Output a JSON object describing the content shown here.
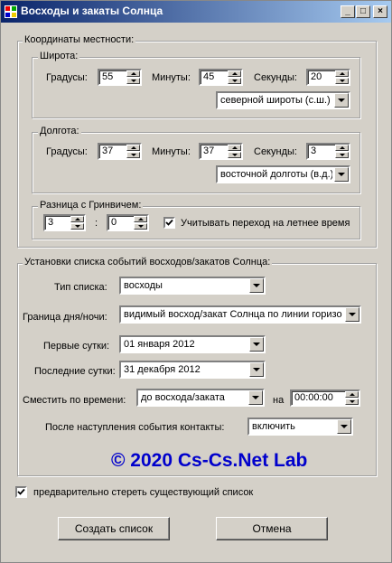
{
  "window": {
    "title": "Восходы и закаты Солнца",
    "min_label": "_",
    "max_label": "□",
    "close_label": "×"
  },
  "coords": {
    "label": "Координаты местности:",
    "lat": {
      "label": "Широта:",
      "deg_label": "Градусы:",
      "deg": "55",
      "min_label": "Минуты:",
      "min": "45",
      "sec_label": "Секунды:",
      "sec": "20",
      "hemisphere": "северной широты (с.ш.)"
    },
    "lon": {
      "label": "Долгота:",
      "deg_label": "Градусы:",
      "deg": "37",
      "min_label": "Минуты:",
      "min": "37",
      "sec_label": "Секунды:",
      "sec": "3",
      "hemisphere": "восточной долготы (в.д.)"
    },
    "gmt": {
      "label": "Разница с Гринвичем:",
      "hours": "3",
      "sep": ":",
      "minutes": "0",
      "dst_label": "Учитывать переход на летнее время",
      "dst_checked": true
    }
  },
  "events": {
    "label": "Установки списка событий восходов/закатов Солнца:",
    "list_type_label": "Тип списка:",
    "list_type": "восходы",
    "boundary_label": "Граница дня/ночи:",
    "boundary": "видимый восход/закат Солнца по линии горизо",
    "first_day_label": "Первые сутки:",
    "first_day": "01  января  2012",
    "last_day_label": "Последние сутки:",
    "last_day": "31 декабря  2012",
    "shift_label": "Сместить по времени:",
    "shift": "до восхода/заката",
    "shift_on_label": "на",
    "shift_time": "00:00:00",
    "after_label": "После наступления события контакты:",
    "after": "включить"
  },
  "copyright": "© 2020 Cs-Cs.Net Lab",
  "clear_list": {
    "label": "предварительно стереть существующий список",
    "checked": true
  },
  "buttons": {
    "create": "Создать список",
    "cancel": "Отмена"
  }
}
